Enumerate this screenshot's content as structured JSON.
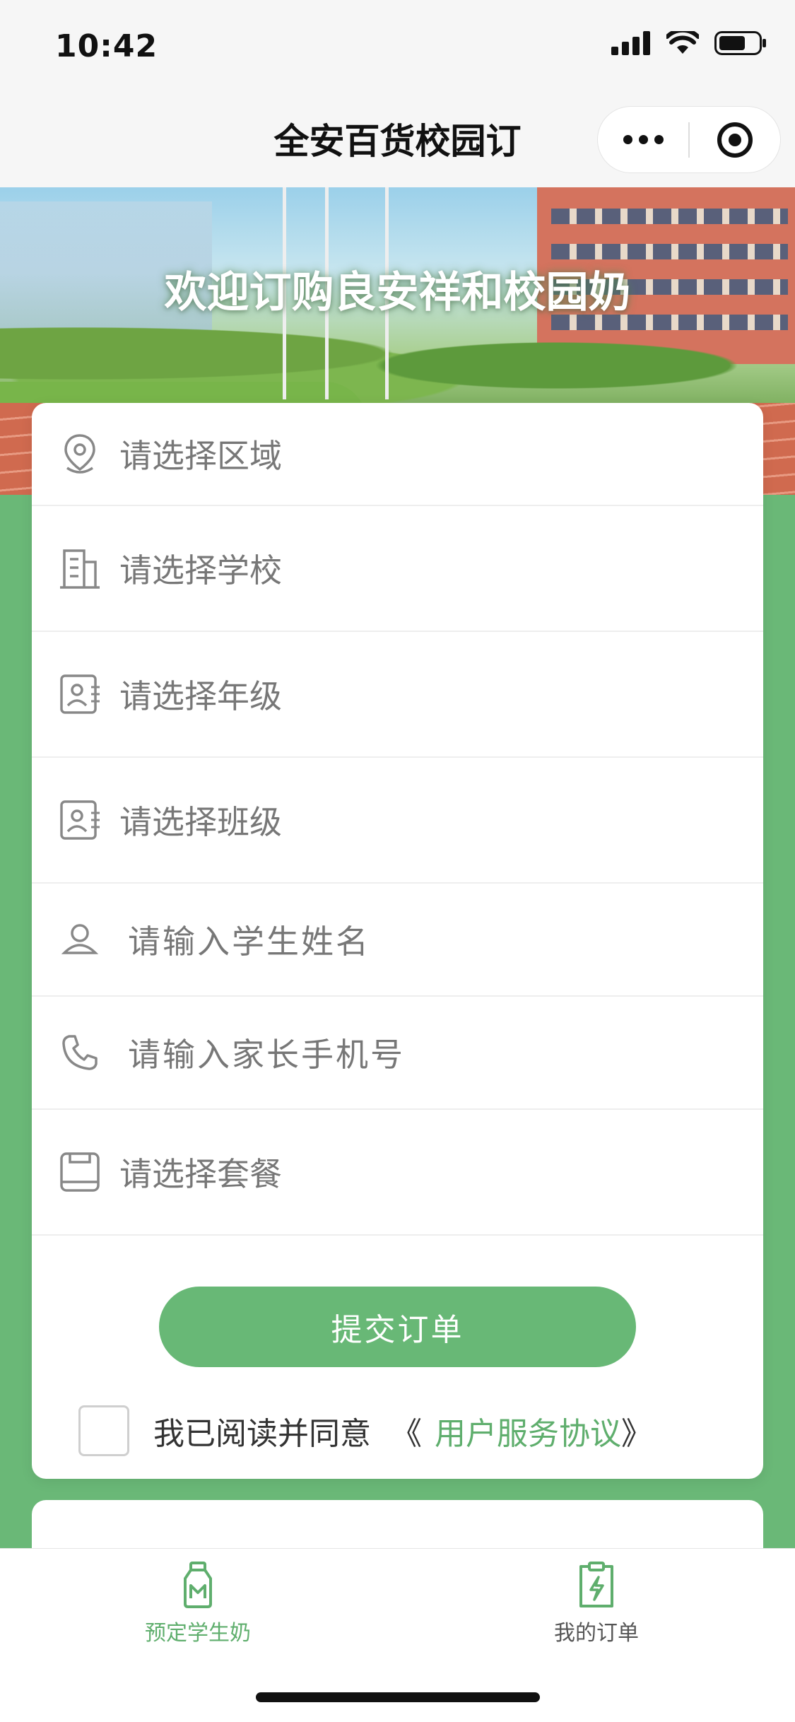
{
  "status_bar": {
    "time": "10:42"
  },
  "nav": {
    "title": "全安百货校园订",
    "more_icon": "more-dots-icon",
    "close_icon": "target-icon"
  },
  "banner": {
    "text": "欢迎订购良安祥和校园奶"
  },
  "form": {
    "fields": [
      {
        "icon": "location-pin-icon",
        "placeholder": "请选择区域"
      },
      {
        "icon": "building-icon",
        "placeholder": "请选择学校"
      },
      {
        "icon": "id-card-icon",
        "placeholder": "请选择年级"
      },
      {
        "icon": "id-card-icon",
        "placeholder": "请选择班级"
      },
      {
        "icon": "user-icon",
        "placeholder": "请输入学生姓名"
      },
      {
        "icon": "phone-icon",
        "placeholder": "请输入家长手机号"
      },
      {
        "icon": "package-icon",
        "placeholder": "请选择套餐"
      }
    ],
    "submit_label": "提交订单",
    "agree_prefix": "我已阅读并同意",
    "agree_open": "《",
    "agree_link": "用户服务协议",
    "agree_close": "》"
  },
  "tabbar": {
    "tabs": [
      {
        "label": "预定学生奶",
        "icon": "milk-bottle-icon",
        "active": true
      },
      {
        "label": "我的订单",
        "icon": "clipboard-bolt-icon",
        "active": false
      }
    ]
  },
  "colors": {
    "accent": "#68b876",
    "page_bg": "#6ab877",
    "active_tab": "#5fae6d",
    "inactive_tab": "#555555"
  }
}
